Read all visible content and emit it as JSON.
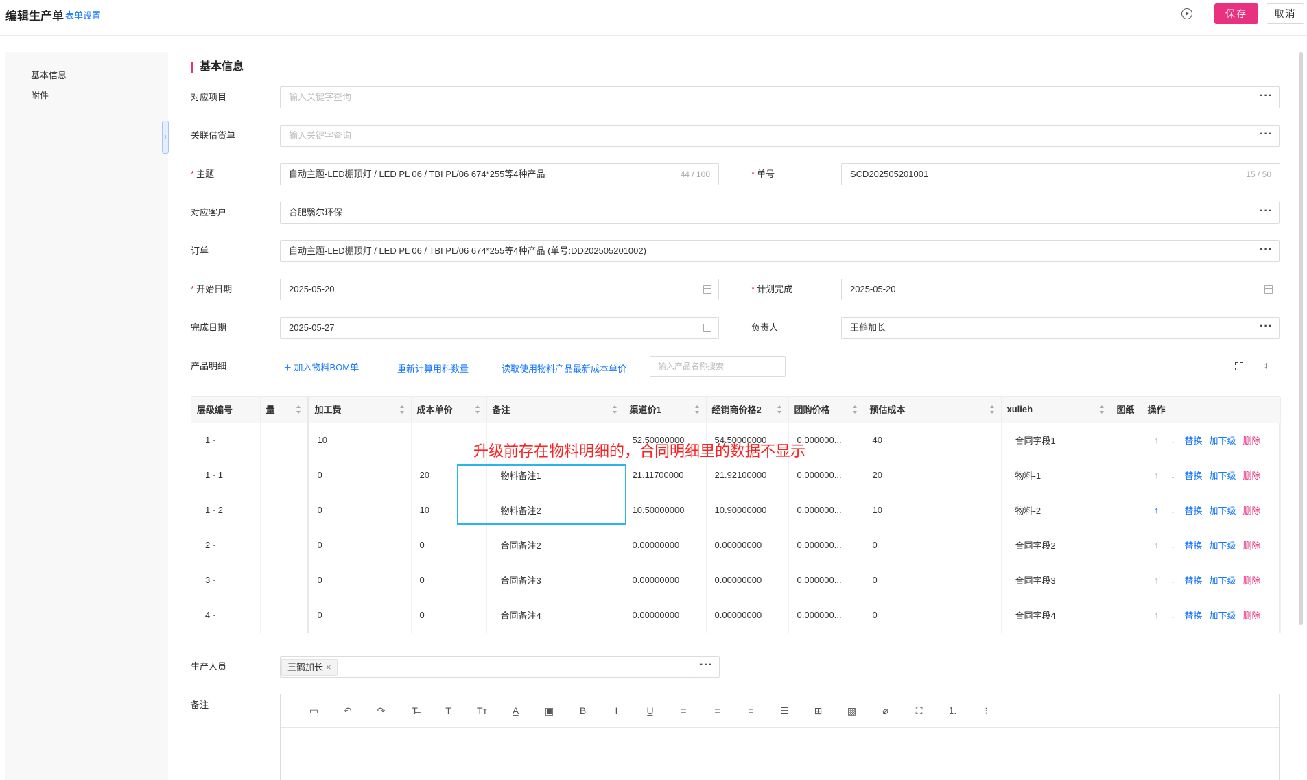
{
  "header": {
    "title": "编辑生产单",
    "form_settings": "表单设置",
    "save_label": "保存",
    "cancel_label": "取消"
  },
  "sidebar": {
    "items": [
      {
        "label": "基本信息"
      },
      {
        "label": "附件"
      }
    ]
  },
  "section": {
    "title": "基本信息"
  },
  "form": {
    "project": {
      "label": "对应项目",
      "placeholder": "输入关键字查询"
    },
    "borrow": {
      "label": "关联借货单",
      "placeholder": "输入关键字查询"
    },
    "subject": {
      "label": "主题",
      "value": "自动主题-LED棚顶灯 / LED PL 06 / TBI PL/06 674*255等4种产品",
      "count": "44 / 100"
    },
    "order_no": {
      "label": "单号",
      "value": "SCD202505201001",
      "count": "15 / 50"
    },
    "customer": {
      "label": "对应客户",
      "value": "合肥翳尔环保"
    },
    "order": {
      "label": "订单",
      "value": "自动主题-LED棚顶灯 / LED PL 06 / TBI PL/06 674*255等4种产品 (单号:DD202505201002)"
    },
    "start_date": {
      "label": "开始日期",
      "value": "2025-05-20"
    },
    "plan_done": {
      "label": "计划完成",
      "value": "2025-05-20"
    },
    "done_date": {
      "label": "完成日期",
      "value": "2025-05-27"
    },
    "owner": {
      "label": "负责人",
      "value": "王鹤加长"
    },
    "product_detail": {
      "label": "产品明细"
    },
    "staff": {
      "label": "生产人员",
      "tag": "王鹤加长"
    },
    "remark": {
      "label": "备注"
    }
  },
  "toolbar": {
    "add_bom": "加入物料BOM单",
    "recalc": "重新计算用料数量",
    "read_cost": "读取使用物料产品最新成本单价",
    "search_placeholder": "输入产品名称搜索"
  },
  "table": {
    "headers": [
      "层级编号",
      "量",
      "加工费",
      "成本单价",
      "备注",
      "渠道价1",
      "经销商价格2",
      "团购价格",
      "预估成本",
      "xulieh",
      "图纸",
      "操作"
    ],
    "rows": [
      {
        "lvl": "1 ·",
        "fee": "10",
        "cost": "",
        "note": "",
        "ch1": "52.50000000",
        "dealer": "54.50000000",
        "group": "0.000000...",
        "est": "40",
        "xulieh": "合同字段1",
        "up": false,
        "down": false
      },
      {
        "lvl": "1 · 1",
        "fee": "0",
        "cost": "20",
        "note": "物料备注1",
        "ch1": "21.11700000",
        "dealer": "21.92100000",
        "group": "0.000000...",
        "est": "20",
        "xulieh": "物料-1",
        "up": false,
        "down": true
      },
      {
        "lvl": "1 · 2",
        "fee": "0",
        "cost": "10",
        "note": "物料备注2",
        "ch1": "10.50000000",
        "dealer": "10.90000000",
        "group": "0.000000...",
        "est": "10",
        "xulieh": "物料-2",
        "up": true,
        "down": false
      },
      {
        "lvl": "2 ·",
        "fee": "0",
        "cost": "0",
        "note": "合同备注2",
        "ch1": "0.00000000",
        "dealer": "0.00000000",
        "group": "0.000000...",
        "est": "0",
        "xulieh": "合同字段2",
        "up": false,
        "down": false
      },
      {
        "lvl": "3 ·",
        "fee": "0",
        "cost": "0",
        "note": "合同备注3",
        "ch1": "0.00000000",
        "dealer": "0.00000000",
        "group": "0.000000...",
        "est": "0",
        "xulieh": "合同字段3",
        "up": false,
        "down": false
      },
      {
        "lvl": "4 ·",
        "fee": "0",
        "cost": "0",
        "note": "合同备注4",
        "ch1": "0.00000000",
        "dealer": "0.00000000",
        "group": "0.000000...",
        "est": "0",
        "xulieh": "合同字段4",
        "up": false,
        "down": false
      }
    ],
    "ops": {
      "replace": "替换",
      "add_child": "加下级",
      "delete": "删除"
    }
  },
  "annotation": "升级前存在物料明细的，合同明细里的数据不显示",
  "colors": {
    "accent": "#e8327f",
    "link": "#1677ff",
    "annotation": "#ff1f1f",
    "highlight": "#2cb6e6"
  },
  "editor_toolbar": [
    "layout-icon",
    "undo-icon",
    "redo-icon",
    "strikethrough-icon",
    "font-icon",
    "font-size-icon",
    "font-color-icon",
    "bg-color-icon",
    "bold-icon",
    "italic-icon",
    "underline-icon",
    "align-left-icon",
    "align-center-icon",
    "align-right-icon",
    "justify-icon",
    "table-icon",
    "image-icon",
    "attachment-icon",
    "fullscreen-icon",
    "ordered-list-icon",
    "bullet-list-icon"
  ]
}
